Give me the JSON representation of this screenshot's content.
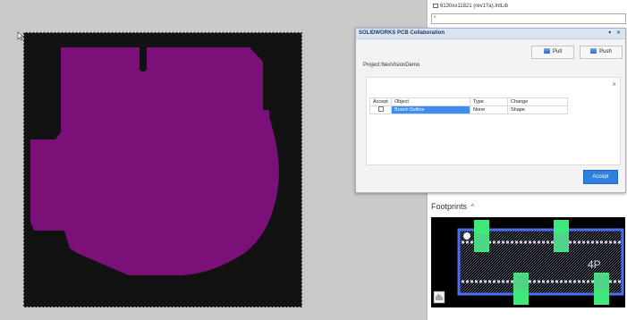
{
  "library_bar": {
    "text": "6130xx11821 (rev1?a).IntLib"
  },
  "library_input": {
    "value": "*"
  },
  "collab_dialog": {
    "title": "SOLIDWORKS PCB Collaboration",
    "controls": "▾ ✕",
    "pull_label": "Pull",
    "push_label": "Push",
    "project_label": "Project:NexVisionDemo",
    "close_glyph": "×",
    "table": {
      "headers": [
        "Accept",
        "Object",
        "Type",
        "Change"
      ],
      "rows": [
        {
          "accept": false,
          "object": "Board Outline",
          "type": "None",
          "change": "Shape"
        }
      ]
    },
    "accept_label": "Accept"
  },
  "footprints": {
    "header": "Footprints",
    "chevron": "^"
  },
  "footprint_preview": {
    "pad_label": "4P"
  },
  "colors": {
    "board_fill": "#7b1178",
    "board_background": "#121212",
    "pad_green": "#3ee87a",
    "outline_blue": "#4a6ff0",
    "accent_blue": "#3d8ef0"
  }
}
